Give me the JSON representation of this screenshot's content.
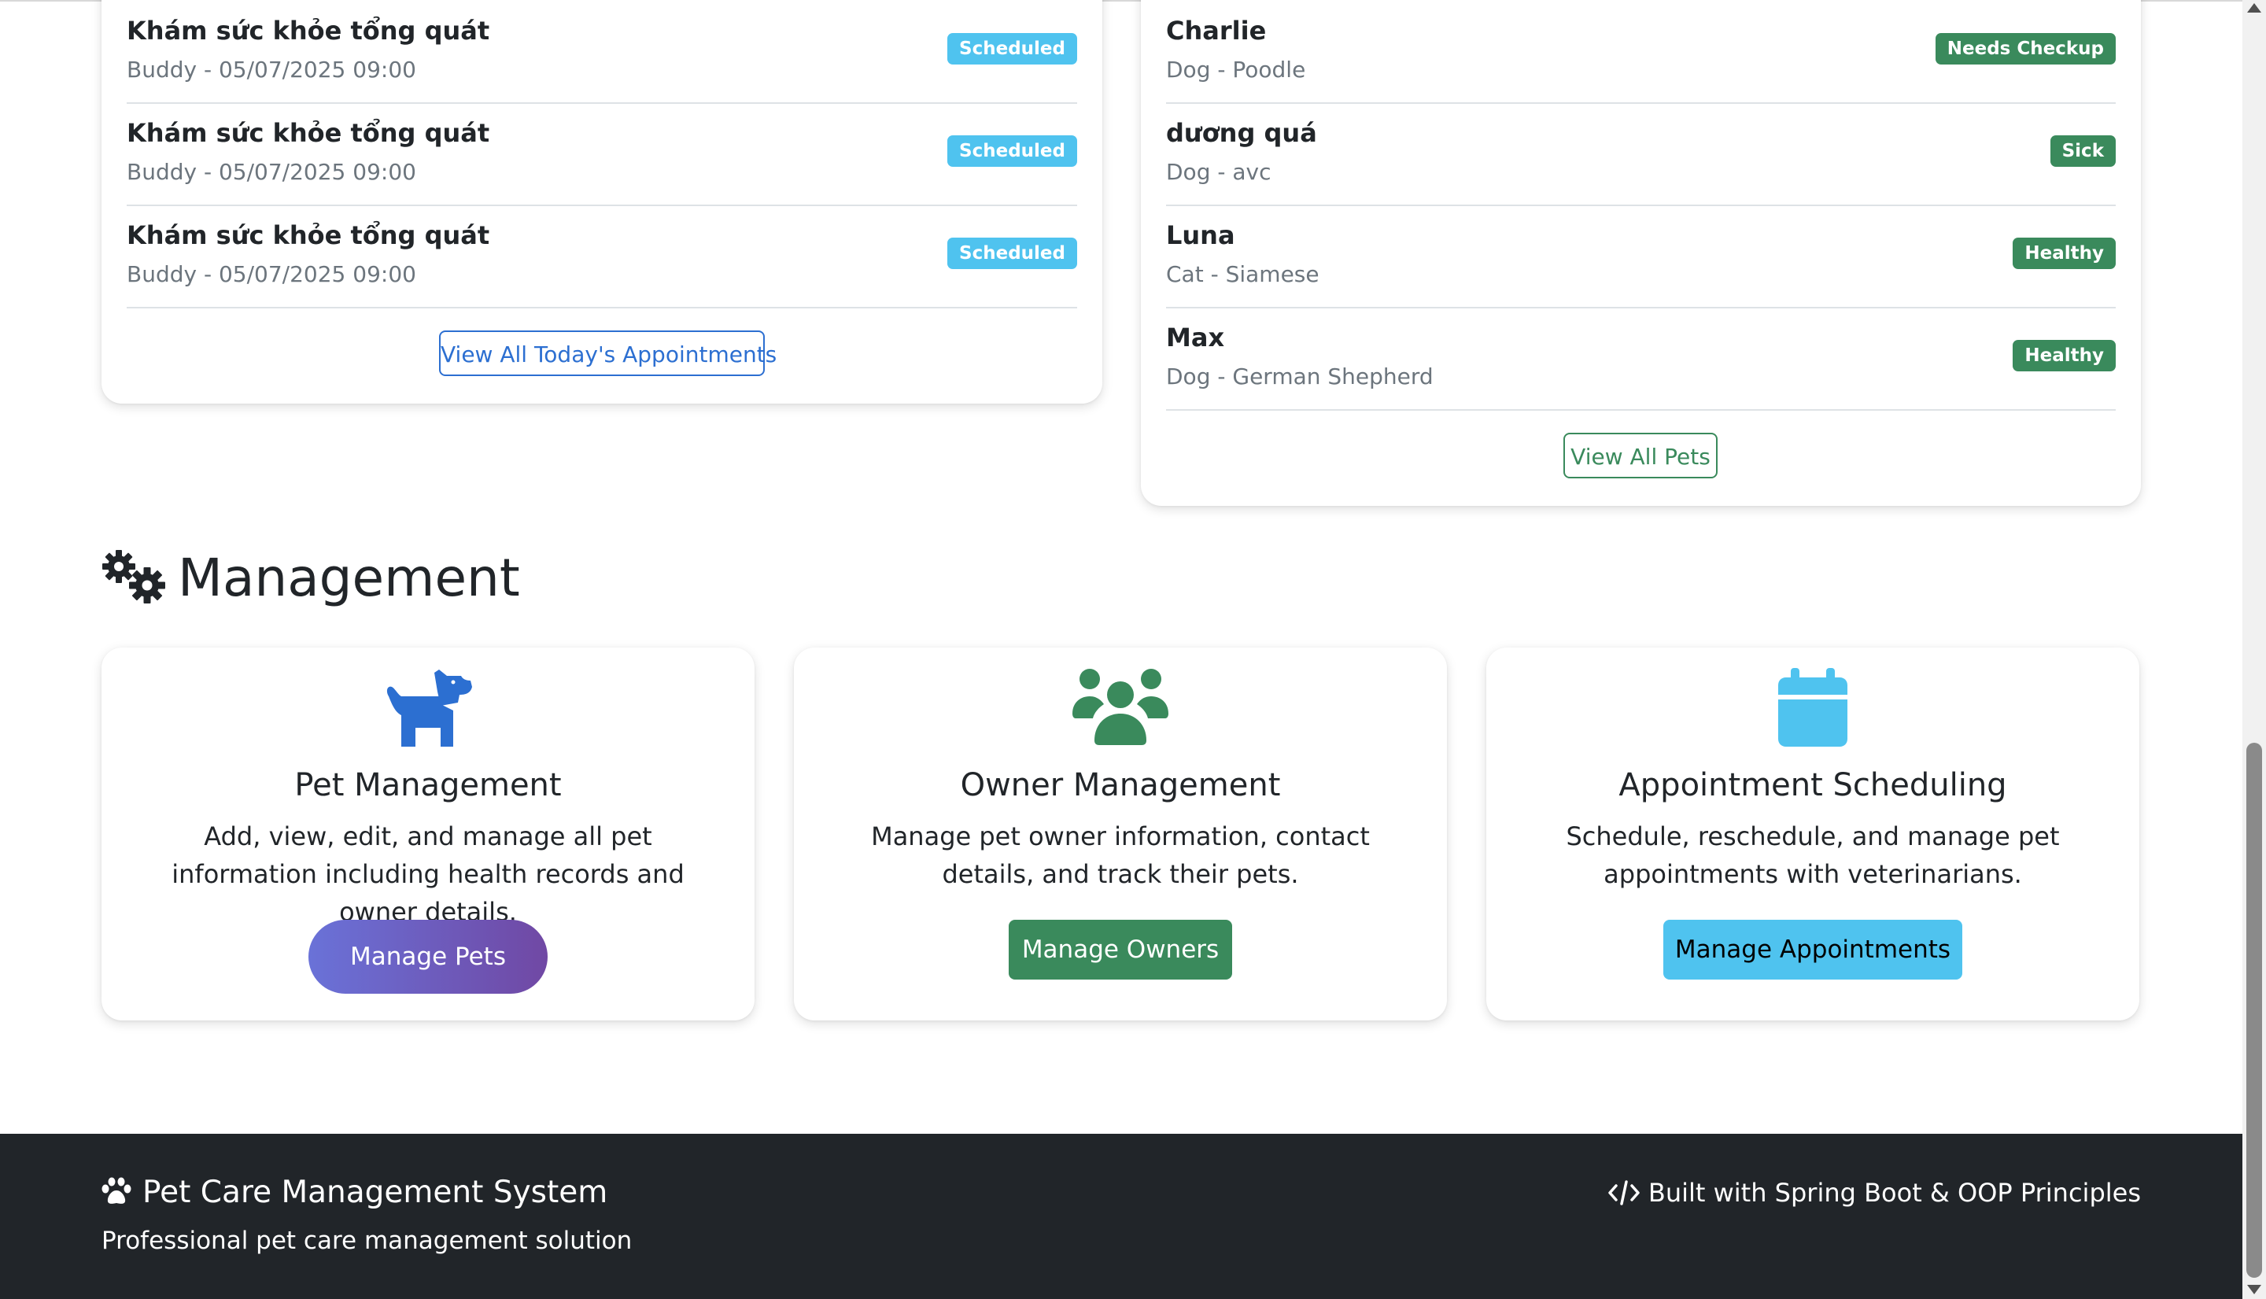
{
  "appointments": {
    "items": [
      {
        "title": "Khám sức khỏe tổng quát",
        "subtitle": "Buddy - 05/07/2025 09:00",
        "status": "Scheduled"
      },
      {
        "title": "Khám sức khỏe tổng quát",
        "subtitle": "Buddy - 05/07/2025 09:00",
        "status": "Scheduled"
      },
      {
        "title": "Khám sức khỏe tổng quát",
        "subtitle": "Buddy - 05/07/2025 09:00",
        "status": "Scheduled"
      }
    ],
    "view_all_label": "View All Today's Appointments"
  },
  "pets": {
    "items": [
      {
        "name": "Charlie",
        "subtitle": "Dog - Poodle",
        "status": "Needs Checkup"
      },
      {
        "name": "dương quá",
        "subtitle": "Dog - avc",
        "status": "Sick"
      },
      {
        "name": "Luna",
        "subtitle": "Cat - Siamese",
        "status": "Healthy"
      },
      {
        "name": "Max",
        "subtitle": "Dog - German Shepherd",
        "status": "Healthy"
      }
    ],
    "view_all_label": "View All Pets"
  },
  "management": {
    "heading": "Management",
    "cards": [
      {
        "icon": "dog-icon",
        "title": "Pet Management",
        "description": "Add, view, edit, and manage all pet information including health records and owner details.",
        "button": "Manage Pets"
      },
      {
        "icon": "users-icon",
        "title": "Owner Management",
        "description": "Manage pet owner information, contact details, and track their pets.",
        "button": "Manage Owners"
      },
      {
        "icon": "calendar-icon",
        "title": "Appointment Scheduling",
        "description": "Schedule, reschedule, and manage pet appointments with veterinarians.",
        "button": "Manage Appointments"
      }
    ]
  },
  "footer": {
    "brand": "Pet Care Management System",
    "tagline": "Professional pet care management solution",
    "built_with": "Built with Spring Boot & OOP Principles"
  },
  "colors": {
    "primary": "#2c6fd1",
    "success": "#3a8a5c",
    "info": "#4fc3ef",
    "purple_gradient_start": "#6a72d8",
    "purple_gradient_end": "#7048a4",
    "footer_bg": "#212529"
  }
}
